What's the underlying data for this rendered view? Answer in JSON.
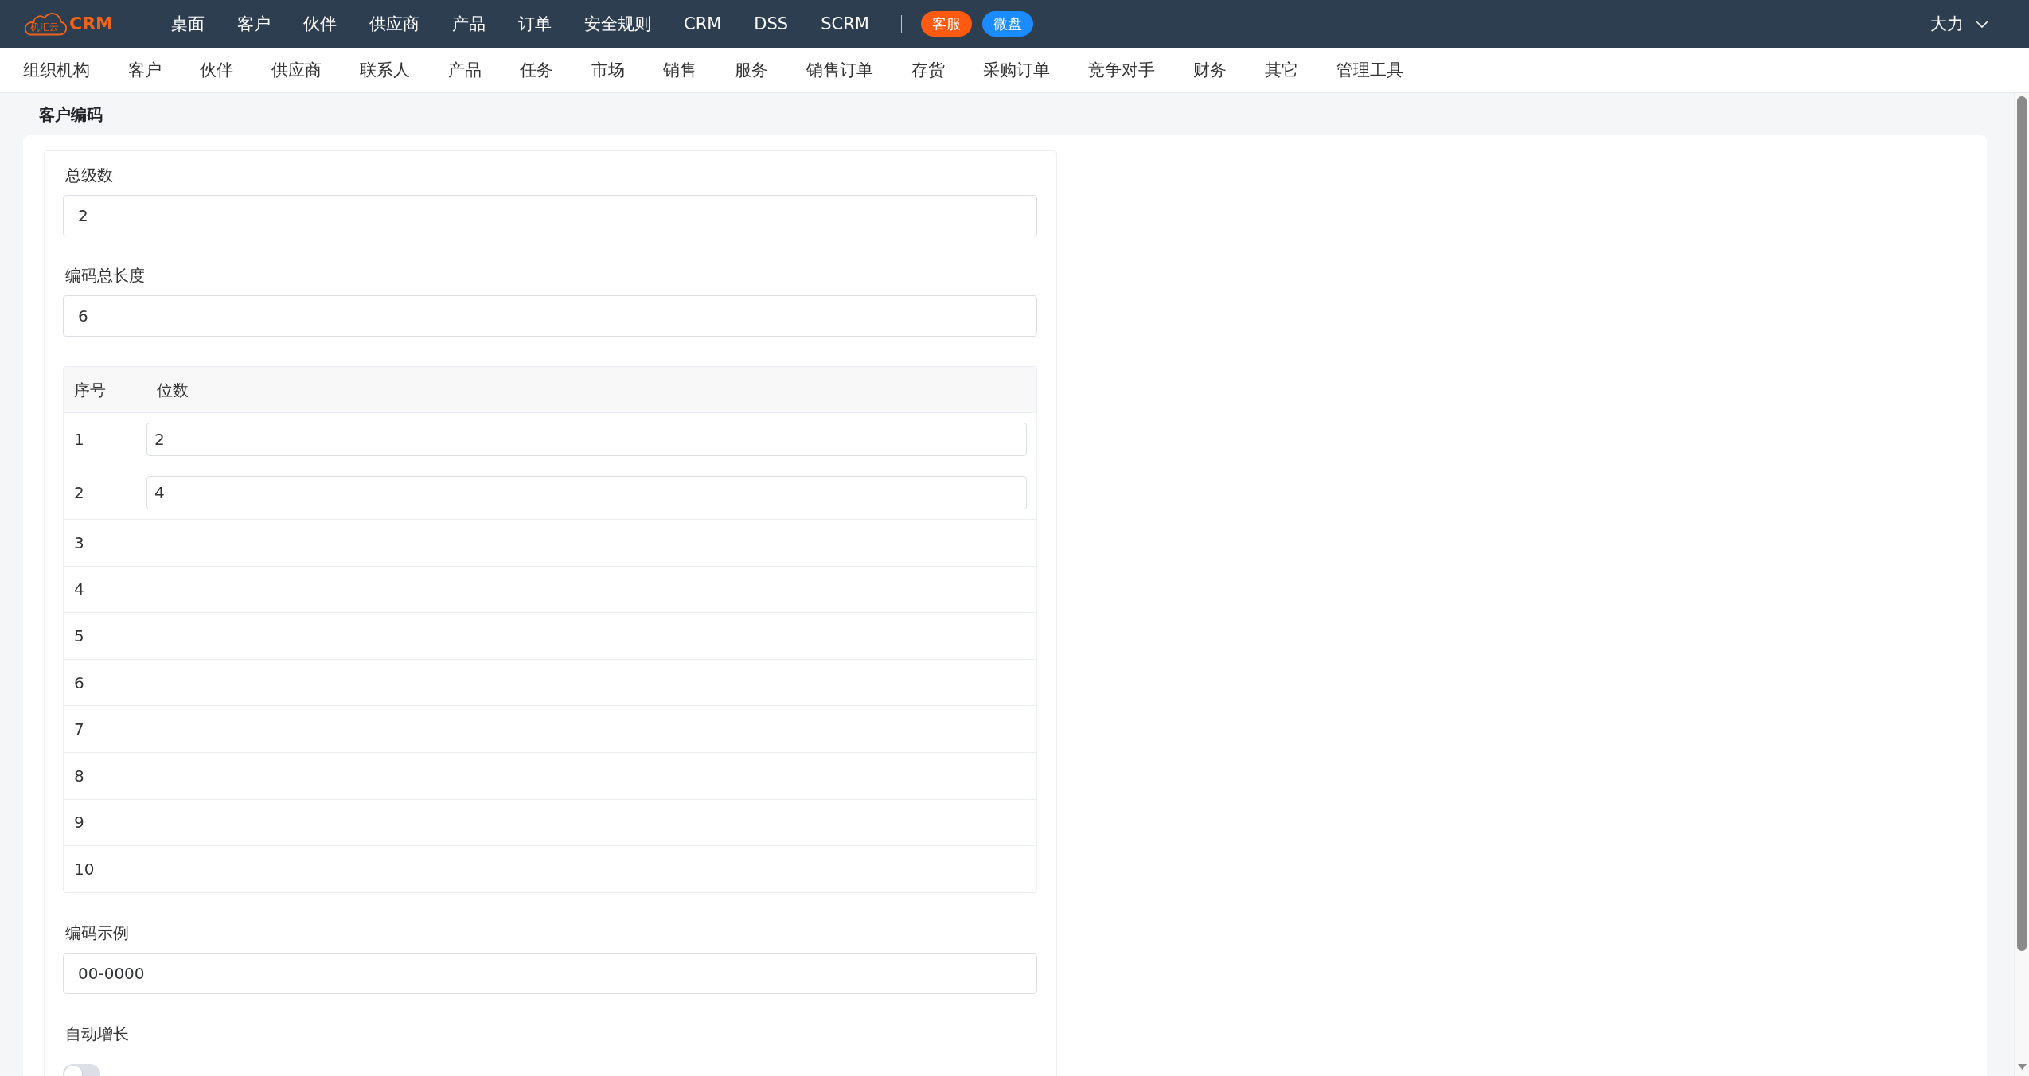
{
  "top_bar": {
    "logo": {
      "badge": "机汇云",
      "name": "CRM"
    },
    "nav": [
      "桌面",
      "客户",
      "伙伴",
      "供应商",
      "产品",
      "订单",
      "安全规则",
      "CRM",
      "DSS",
      "SCRM"
    ],
    "buttons": [
      {
        "label": "客服",
        "color": "#ff5a0f"
      },
      {
        "label": "微盘",
        "color": "#1a8cff"
      }
    ],
    "user": "大力"
  },
  "module_nav": [
    "组织机构",
    "客户",
    "伙伴",
    "供应商",
    "联系人",
    "产品",
    "任务",
    "市场",
    "销售",
    "服务",
    "销售订单",
    "存货",
    "采购订单",
    "竞争对手",
    "财务",
    "其它",
    "管理工具"
  ],
  "page": {
    "title": "客户编码"
  },
  "form": {
    "total_levels": {
      "label": "总级数",
      "value": "2"
    },
    "code_length": {
      "label": "编码总长度",
      "value": "6"
    },
    "levels_table": {
      "columns": [
        "序号",
        "位数"
      ],
      "rows": [
        {
          "index": "1",
          "digits": "2"
        },
        {
          "index": "2",
          "digits": "4"
        },
        {
          "index": "3"
        },
        {
          "index": "4"
        },
        {
          "index": "5"
        },
        {
          "index": "6"
        },
        {
          "index": "7"
        },
        {
          "index": "8"
        },
        {
          "index": "9"
        },
        {
          "index": "10"
        }
      ]
    },
    "code_example": {
      "label": "编码示例",
      "value": "00-0000"
    },
    "auto_increment": {
      "label": "自动增长",
      "on": false
    }
  }
}
